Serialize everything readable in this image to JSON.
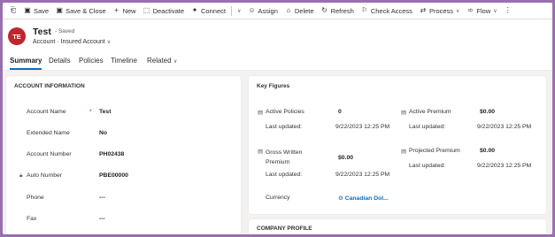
{
  "commandbar": {
    "items": [
      {
        "icon": "back-arrow-icon",
        "label": ""
      },
      {
        "icon": "save-icon",
        "label": "Save"
      },
      {
        "icon": "save-close-icon",
        "label": "Save & Close"
      },
      {
        "icon": "plus-icon",
        "label": "New"
      },
      {
        "icon": "deactivate-icon",
        "label": "Deactivate"
      },
      {
        "icon": "connect-icon",
        "label": "Connect"
      },
      {
        "icon": "assign-icon",
        "label": "Assign"
      },
      {
        "icon": "delete-icon",
        "label": "Delete"
      },
      {
        "icon": "refresh-icon",
        "label": "Refresh"
      },
      {
        "icon": "check-access-icon",
        "label": "Check Access"
      },
      {
        "icon": "process-icon",
        "label": "Process"
      },
      {
        "icon": "flow-icon",
        "label": "Flow"
      }
    ]
  },
  "record": {
    "initials": "TE",
    "title": "Test",
    "saved": "- Saved",
    "entity": "Account",
    "separator": "·",
    "form": "Insured Account"
  },
  "tabs": [
    "Summary",
    "Details",
    "Policies",
    "Timeline",
    "Related"
  ],
  "account_info": {
    "title": "ACCOUNT INFORMATION",
    "fields": [
      {
        "label": "Account Name",
        "value": "Test",
        "required": "*"
      },
      {
        "label": "Extended Name",
        "value": "No"
      },
      {
        "label": "Account Number",
        "value": "PH02438"
      },
      {
        "label": "Auto Number",
        "value": "PBE00000",
        "locked": true
      },
      {
        "label": "Phone",
        "value": "---"
      },
      {
        "label": "Fax",
        "value": "---"
      }
    ]
  },
  "key_figures": {
    "title": "Key Figures",
    "active_policies": {
      "label": "Active Policies",
      "value": "0",
      "updated_label": "Last updated:",
      "updated": "9/22/2023 12:25 PM"
    },
    "active_premium": {
      "label": "Active Premium",
      "value": "$0.00",
      "updated_label": "Last updated:",
      "updated": "9/22/2023 12:25 PM"
    },
    "gross_written_premium": {
      "label": "Gross Written Premium",
      "value": "$0.00",
      "updated_label": "Last updated:",
      "updated": "9/22/2023 12:25 PM"
    },
    "projected_premium": {
      "label": "Projected Premium",
      "value": "$0.00",
      "updated_label": "Last updated:",
      "updated": "9/22/2023 12:25 PM"
    },
    "currency": {
      "label": "Currency",
      "value": "Canadian Dol..."
    }
  },
  "company_profile": {
    "title": "COMPANY PROFILE"
  },
  "colors": {
    "accent": "#0f6cbd",
    "avatar": "#c0262d",
    "frame": "#9a6fb0"
  }
}
